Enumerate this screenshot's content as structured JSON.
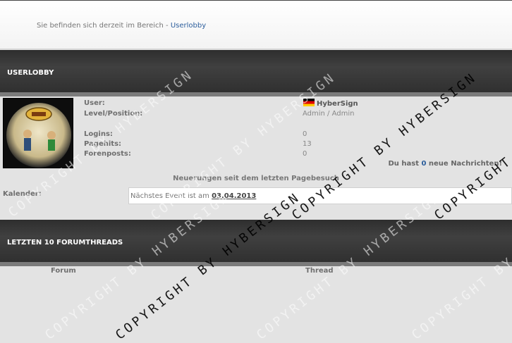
{
  "breadcrumb": {
    "prefix": "Sie befinden sich derzeit im Bereich - ",
    "link": "Userlobby"
  },
  "sections": {
    "userlobby": "USERLOBBY",
    "threads": "LETZTEN 10 FORUMTHREADS"
  },
  "profile": {
    "labels": {
      "user": "User:",
      "level": "Level/Position:",
      "logins": "Logins:",
      "pagehits": "Pagehits:",
      "forenposts": "Forenposts:"
    },
    "username": "HyberSign",
    "level": "Admin / Admin",
    "logins": "0",
    "pagehits": "13",
    "forenposts": "0"
  },
  "messages": {
    "prefix": "Du hast ",
    "count": "0",
    "suffix": " neue Nachrichten!"
  },
  "news_heading": "Neuerungen seit dem letzten Pagebesuch",
  "calendar": {
    "label": "Kalender:",
    "text": "Nächstes Event ist am ",
    "date": "03.04.2013"
  },
  "threads_table": {
    "col_forum": "Forum",
    "col_thread": "Thread"
  },
  "watermark": "COPYRIGHT BY HYBERSIGN",
  "colors": {
    "accent": "#2c5e9c",
    "header_bg": "#333333"
  }
}
